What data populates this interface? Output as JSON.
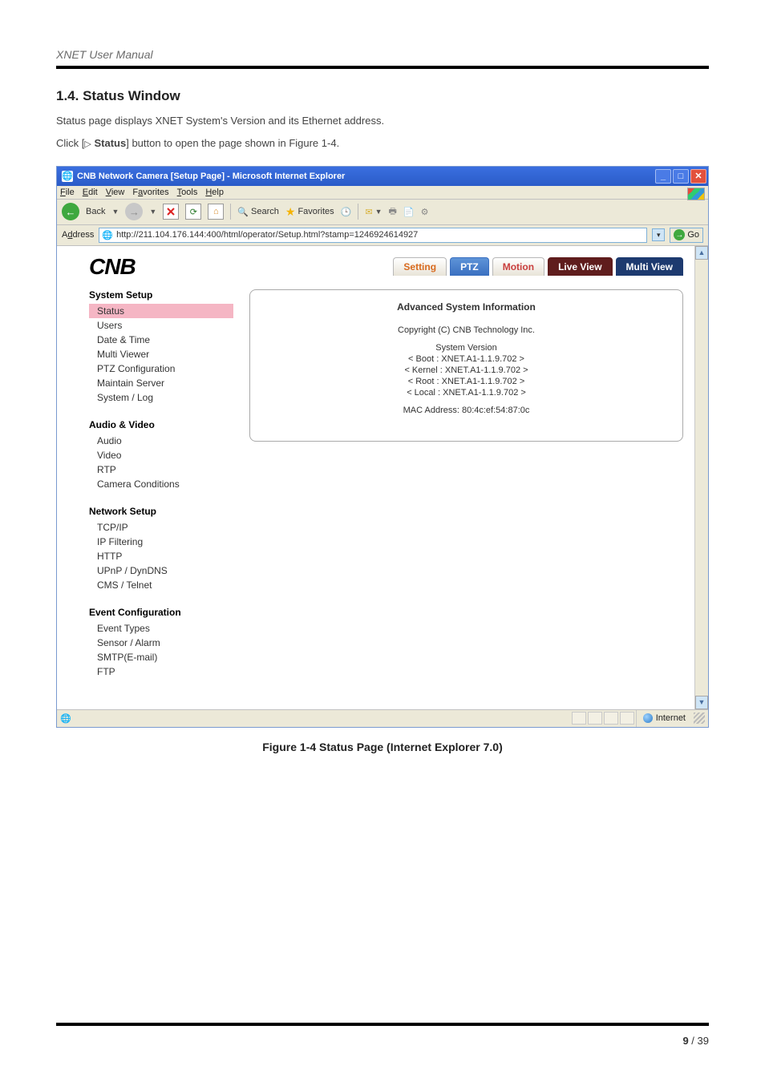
{
  "doc": {
    "header": "XNET User Manual",
    "section_title": "1.4. Status Window",
    "para1": "Status page displays XNET System's Version and its Ethernet address.",
    "para2_pre": "Click [",
    "para2_btn": "Status",
    "para2_post": "] button to open the page shown in Figure 1-4.",
    "figure_caption": "Figure 1-4 Status Page (Internet Explorer 7.0)",
    "page_current": "9",
    "page_sep": " / ",
    "page_total": "39"
  },
  "ie": {
    "title": "CNB Network Camera [Setup Page] - Microsoft Internet Explorer",
    "menus": [
      "File",
      "Edit",
      "View",
      "Favorites",
      "Tools",
      "Help"
    ],
    "toolbar": {
      "back": "Back",
      "search": "Search",
      "favorites": "Favorites"
    },
    "address_label": "Address",
    "url": "http://211.104.176.144:400/html/operator/Setup.html?stamp=1246924614927",
    "go": "Go",
    "status_zone": "Internet"
  },
  "app": {
    "logo": "CNB",
    "tabs": {
      "setting": "Setting",
      "ptz": "PTZ",
      "motion": "Motion",
      "live": "Live View",
      "multi": "Multi View"
    },
    "sidebar": {
      "groups": [
        {
          "title": "System Setup",
          "items": [
            "Status",
            "Users",
            "Date & Time",
            "Multi Viewer",
            "PTZ Configuration",
            "Maintain Server",
            "System / Log"
          ],
          "selected": 0
        },
        {
          "title": "Audio & Video",
          "items": [
            "Audio",
            "Video",
            "RTP",
            "Camera Conditions"
          ]
        },
        {
          "title": "Network Setup",
          "items": [
            "TCP/IP",
            "IP Filtering",
            "HTTP",
            "UPnP / DynDNS",
            "CMS / Telnet"
          ]
        },
        {
          "title": "Event Configuration",
          "items": [
            "Event Types",
            "Sensor / Alarm",
            "SMTP(E-mail)",
            "FTP"
          ]
        }
      ]
    },
    "panel": {
      "title": "Advanced System Information",
      "copyright": "Copyright (C) CNB Technology Inc.",
      "sysver_label": "System Version",
      "lines": [
        "< Boot   : XNET.A1-1.1.9.702 >",
        "< Kernel : XNET.A1-1.1.9.702 >",
        "< Root   : XNET.A1-1.1.9.702 >",
        "< Local  : XNET.A1-1.1.9.702 >"
      ],
      "mac": "MAC Address: 80:4c:ef:54:87:0c"
    }
  }
}
